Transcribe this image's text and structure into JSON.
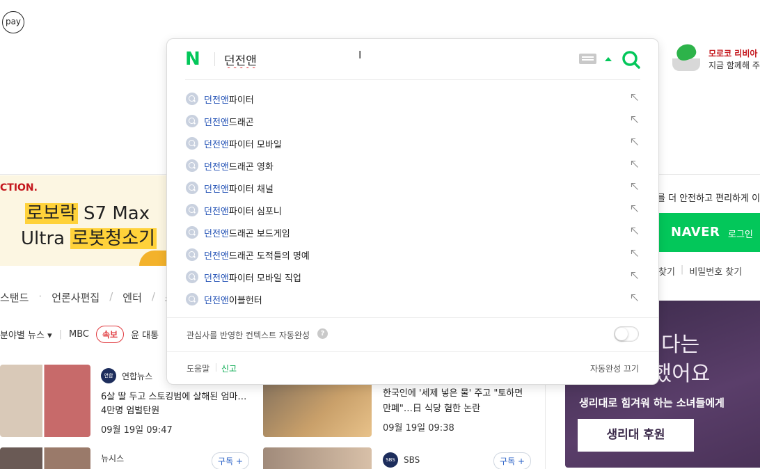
{
  "pay_badge": "pay",
  "promo_ad": {
    "title": "모로코 리비아",
    "subtitle": "지금 함께해 주"
  },
  "banner": {
    "brand": "CTION.",
    "line1_highlight": "로보락",
    "line1_rest": " S7 Max",
    "line2_rest": "Ultra ",
    "line2_highlight": "로봇청소기"
  },
  "nav": {
    "items": [
      "스탠드",
      "언론사편집",
      "엔터",
      "스포"
    ]
  },
  "news_filter": {
    "category": "분야별 뉴스 ▾",
    "press": "MBC",
    "breaking": "속보",
    "headline": "윤 대통"
  },
  "news_cards": [
    {
      "source": "연합뉴스",
      "logo": "연합",
      "title": "6살 딸 두고 스토킹범에 살해된 엄마… 4만명 엄벌탄원",
      "time": "09월 19일 09:47"
    },
    {
      "source": "한국인에 '세제 넣은 물' 주고 \"토하면",
      "logo": "",
      "title": "만폐\"…日 식당 혐한 논란",
      "time": "09월 19일 09:38"
    },
    {
      "source": "뉴시스",
      "logo": "",
      "title": "",
      "time": ""
    },
    {
      "source": "SBS",
      "logo": "SBS",
      "title": "",
      "time": ""
    }
  ],
  "subscribe_label": "구독 +",
  "login": {
    "note": "를 더 안전하고 편리하게 이",
    "brand": "NAVER",
    "button": "로그인",
    "find_id": "찾기",
    "find_pw": "비밀번호 찾기"
  },
  "charity": {
    "big1": "다는",
    "big2": "작했어요",
    "sub": "생리대로 힘겨워 하는 소녀들에게",
    "button": "생리대 후원"
  },
  "search": {
    "logo": "N",
    "query": "던전앤",
    "match": "던전앤",
    "suggestions": [
      {
        "rest": "파이터"
      },
      {
        "rest": "드래곤"
      },
      {
        "rest": "파이터 모바일"
      },
      {
        "rest": "드래곤 영화"
      },
      {
        "rest": "파이터 채널"
      },
      {
        "rest": "파이터 심포니"
      },
      {
        "rest": "드래곤 보드게임"
      },
      {
        "rest": "드래곤 도적들의 명예"
      },
      {
        "rest": "파이터 모바일 직업"
      },
      {
        "rest": "이블헌터"
      }
    ],
    "context_label": "관심사를 반영한 컨텍스트 자동완성",
    "context_help": "?",
    "footer": {
      "help": "도움말",
      "report": "신고",
      "autocomplete_off": "자동완성 끄기"
    }
  },
  "colors": {
    "naver_green": "#03c75a",
    "match_blue": "#1f4fb4",
    "breaking_red": "#e0393e"
  }
}
